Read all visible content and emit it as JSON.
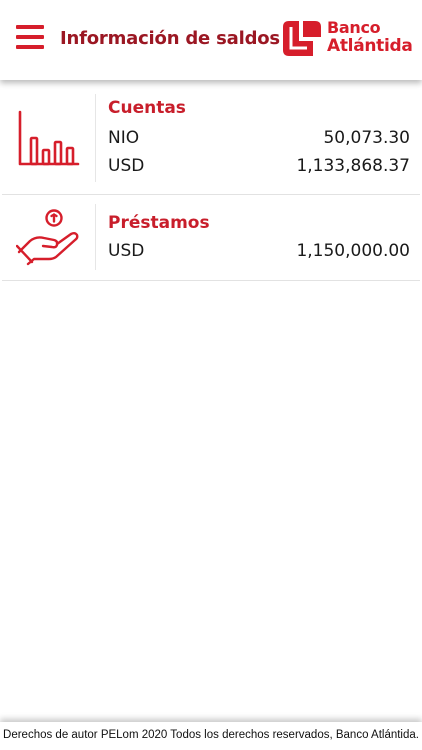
{
  "header": {
    "title": "Información de saldos",
    "menu_icon": "hamburger-menu-icon",
    "brand": {
      "line1": "Banco",
      "line2": "Atlántida",
      "color": "#d61e2b"
    }
  },
  "colors": {
    "accent": "#d61e2b",
    "title": "#9b1723",
    "text": "#1a1a1a"
  },
  "accounts": {
    "title": "Cuentas",
    "icon": "bar-chart-icon",
    "rows": [
      {
        "currency": "NIO",
        "amount": "50,073.30"
      },
      {
        "currency": "USD",
        "amount": "1,133,868.37"
      }
    ]
  },
  "loans": {
    "title": "Préstamos",
    "icon": "hand-coin-icon",
    "rows": [
      {
        "currency": "USD",
        "amount": "1,150,000.00"
      }
    ]
  },
  "footer": {
    "text": "Derechos de autor PELom 2020 Todos los derechos reservados, Banco Atlántida."
  }
}
